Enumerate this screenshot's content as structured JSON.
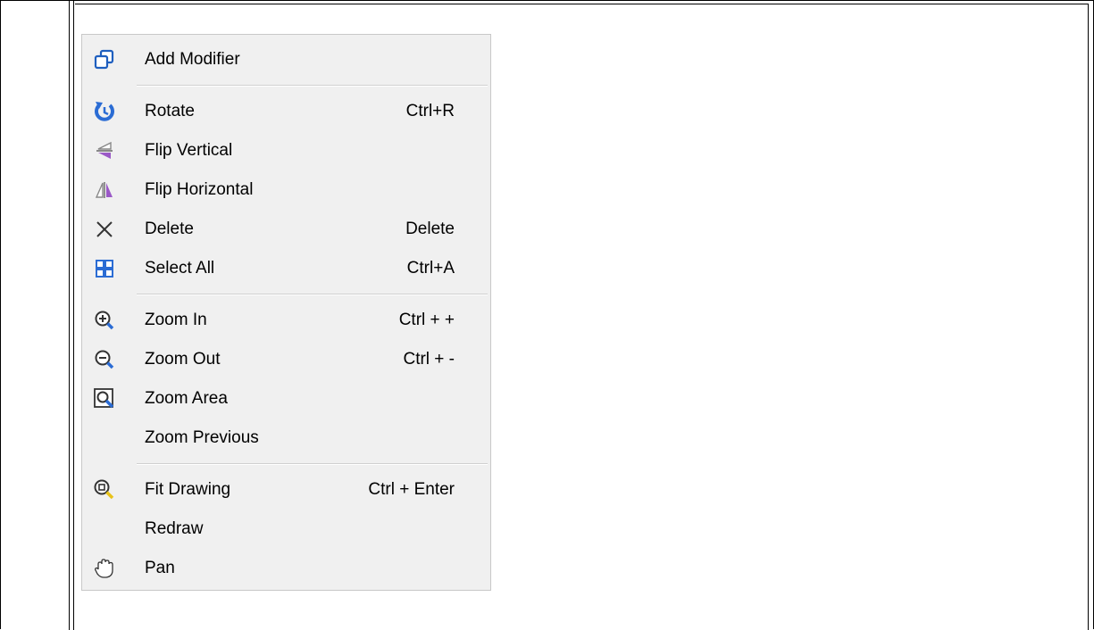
{
  "menu": {
    "add_modifier": {
      "label": "Add Modifier",
      "icon": "add-modifier-icon"
    },
    "rotate": {
      "label": "Rotate",
      "shortcut": "Ctrl+R",
      "icon": "rotate-icon"
    },
    "flip_vertical": {
      "label": "Flip Vertical",
      "icon": "flip-vertical-icon"
    },
    "flip_horizontal": {
      "label": "Flip Horizontal",
      "icon": "flip-horizontal-icon"
    },
    "delete": {
      "label": "Delete",
      "shortcut": "Delete",
      "icon": "close-icon"
    },
    "select_all": {
      "label": "Select All",
      "shortcut": "Ctrl+A",
      "icon": "select-all-icon"
    },
    "zoom_in": {
      "label": "Zoom In",
      "shortcut": "Ctrl + +",
      "icon": "zoom-in-icon"
    },
    "zoom_out": {
      "label": "Zoom Out",
      "shortcut": "Ctrl + -",
      "icon": "zoom-out-icon"
    },
    "zoom_area": {
      "label": "Zoom Area",
      "icon": "zoom-area-icon"
    },
    "zoom_previous": {
      "label": "Zoom Previous"
    },
    "fit_drawing": {
      "label": "Fit Drawing",
      "shortcut": "Ctrl + Enter",
      "icon": "fit-drawing-icon"
    },
    "redraw": {
      "label": "Redraw"
    },
    "pan": {
      "label": "Pan",
      "icon": "hand-icon"
    }
  },
  "colors": {
    "menu_background": "#f0f0f0",
    "accent_blue": "#2b6cd4",
    "accent_purple": "#9b59c7",
    "separator": "#d0d0d0"
  }
}
